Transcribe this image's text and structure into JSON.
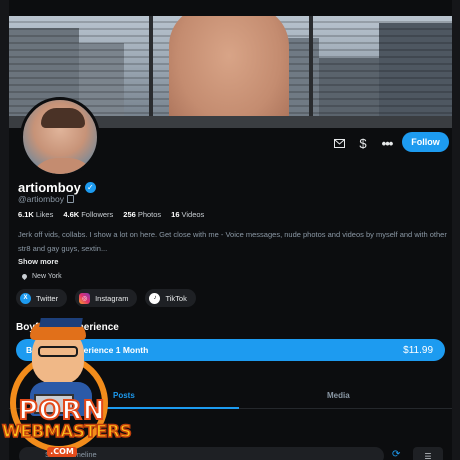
{
  "profile": {
    "display_name": "artiomboy",
    "handle": "@artiomboy",
    "verified_icon": "check-badge-icon",
    "stats": {
      "likes_value": "6.1K",
      "likes_label": "Likes",
      "followers_value": "4.6K",
      "followers_label": "Followers",
      "photos_value": "256",
      "photos_label": "Photos",
      "videos_value": "16",
      "videos_label": "Videos"
    },
    "bio": "Jerk off vids, collabs. I show a lot on here.  Get close with me - Voice messages, nude photos and videos by myself and with other str8 and gay guys, sextin...",
    "show_more": "Show more",
    "location": "New York"
  },
  "actions": {
    "mail_icon": "envelope-icon",
    "tip_icon": "$",
    "more_icon": "•••",
    "follow_label": "Follow"
  },
  "socials": [
    {
      "label": "Twitter",
      "icon": "X"
    },
    {
      "label": "Instagram",
      "icon": "◎"
    },
    {
      "label": "TikTok",
      "icon": "♪"
    }
  ],
  "subscription": {
    "title": "Boyfriend Experience",
    "plan_label": "Boyfriend Experience 1 Month",
    "price": "$11.99"
  },
  "tabs": [
    {
      "label": "Posts",
      "active": true
    },
    {
      "label": "Media",
      "active": false
    }
  ],
  "search": {
    "placeholder": "Search timeline"
  },
  "watermark": {
    "line1": "PORN",
    "line2": "WEBMASTERS",
    "line3": ".COM"
  },
  "colors": {
    "accent": "#1d9bf0",
    "background": "#0c0d0f",
    "watermark_orange": "#f28c1b"
  }
}
